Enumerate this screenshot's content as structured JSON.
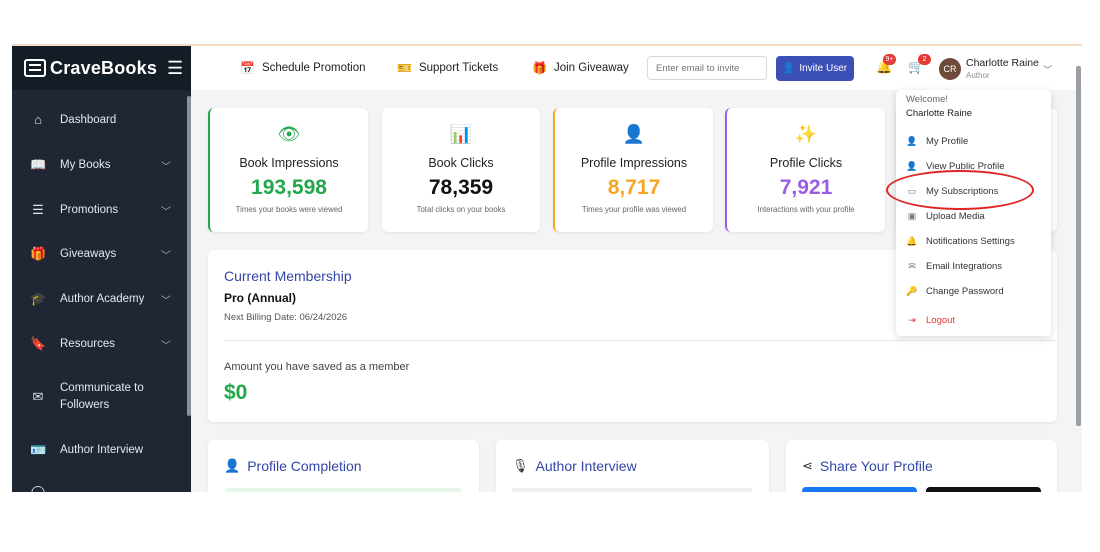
{
  "brand": {
    "name": "CraveBooks"
  },
  "sidebar": {
    "items": [
      {
        "label": "Dashboard",
        "icon": "home-icon"
      },
      {
        "label": "My Books",
        "icon": "book-icon"
      },
      {
        "label": "Promotions",
        "icon": "list-icon"
      },
      {
        "label": "Giveaways",
        "icon": "gift-icon"
      },
      {
        "label": "Author Academy",
        "icon": "graduation-cap-icon"
      },
      {
        "label": "Resources",
        "icon": "bookmark-icon"
      },
      {
        "label": "Communicate to",
        "label2": "Followers",
        "icon": "mail-icon"
      },
      {
        "label": "Author Interview",
        "icon": "id-card-icon"
      }
    ]
  },
  "header": {
    "schedule_promotion": "Schedule Promotion",
    "support_tickets": "Support Tickets",
    "join_giveaway": "Join Giveaway",
    "invite_placeholder": "Enter email to invite",
    "invite_button": "Invite User",
    "notifications_badge": "9+",
    "cart_badge": "2",
    "avatar_initials": "CR",
    "user_name": "Charlotte Raine",
    "user_role": "Author"
  },
  "stats": [
    {
      "label": "Book Impressions",
      "value": "193,598",
      "sub": "Times your books were viewed",
      "color": "#22a74a",
      "icon": "eye-icon"
    },
    {
      "label": "Book Clicks",
      "value": "78,359",
      "sub": "Total clicks on your books",
      "color": "#111111",
      "icon": "bar-chart-icon"
    },
    {
      "label": "Profile Impressions",
      "value": "8,717",
      "sub": "Times your profile was viewed",
      "color": "#f5a623",
      "icon": "user-icon"
    },
    {
      "label": "Profile Clicks",
      "value": "7,921",
      "sub": "Interactions with your profile",
      "color": "#9b5de5",
      "icon": "cursor-click-icon"
    }
  ],
  "membership": {
    "title": "Current Membership",
    "plan": "Pro (Annual)",
    "billing": "Next Billing Date: 06/24/2026",
    "saved_label": "Amount you have saved as a member",
    "saved_value": "$0"
  },
  "bottom": {
    "profile_completion": "Profile Completion",
    "author_interview": "Author Interview",
    "share_profile": "Share Your Profile"
  },
  "dropdown": {
    "welcome": "Welcome!",
    "name": "Charlotte Raine",
    "items": [
      {
        "label": "My Profile",
        "icon": "user-icon"
      },
      {
        "label": "View Public Profile",
        "icon": "user-icon"
      },
      {
        "label": "My Subscriptions",
        "icon": "credit-card-icon"
      },
      {
        "label": "Upload Media",
        "icon": "image-icon"
      },
      {
        "label": "Notifications Settings",
        "icon": "bell-icon"
      },
      {
        "label": "Email Integrations",
        "icon": "mail-icon"
      },
      {
        "label": "Change Password",
        "icon": "key-icon"
      },
      {
        "label": "Logout",
        "icon": "logout-icon"
      }
    ]
  },
  "colors": {
    "accent": "#3c4fb5",
    "sidebar": "#1e2733",
    "logout": "#e53935",
    "highlight_circle": "#e02424"
  }
}
